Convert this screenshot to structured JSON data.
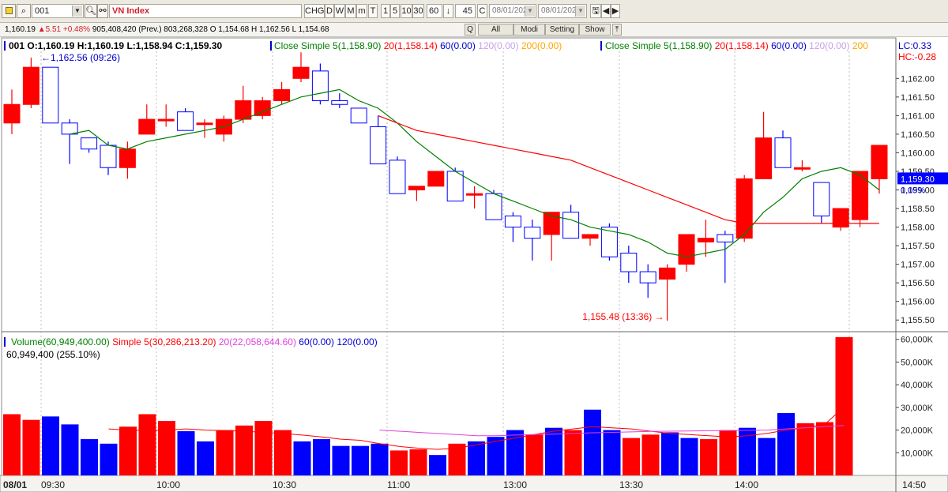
{
  "toolbar": {
    "symbol": "001",
    "index_name": "VN Index",
    "buttons": [
      "CHG",
      "D",
      "W",
      "M",
      "m",
      "T",
      "1",
      "5",
      "10",
      "30"
    ],
    "interval": "60",
    "count": "45",
    "c_label": "C",
    "date_from": "08/01/202",
    "date_to": "08/01/202"
  },
  "quotebar": {
    "last": "1,160.19",
    "change": "5.51",
    "change_pct": "+0.48%",
    "volume": "905,408,420",
    "prev": "(Prev.) 803,268,328",
    "ohl": "O 1,154.68 H 1,162.56 L 1,154.68",
    "buttons": [
      "Q",
      "All",
      "Modi",
      "Setting",
      "Show"
    ]
  },
  "price_panel": {
    "header": "001 O:1,160.19 H:1,160.19 L:1,158.94 C:1,159.30",
    "ma_legend_1": [
      {
        "text": "Close Simple 5(1,158.90)",
        "color": "#008000"
      },
      {
        "text": "20(1,158.14)",
        "color": "#ff0000"
      },
      {
        "text": "60(0.00)",
        "color": "#0000cc"
      },
      {
        "text": "120(0.00)",
        "color": "#c8a0e6"
      },
      {
        "text": "200(0.00)",
        "color": "#ffa500"
      }
    ],
    "ma_legend_2": [
      {
        "text": "Close Simple 5(1,158.90)",
        "color": "#008000"
      },
      {
        "text": "20(1,158.14)",
        "color": "#ff0000"
      },
      {
        "text": "60(0.00)",
        "color": "#0000cc"
      },
      {
        "text": "120(0.00)",
        "color": "#c8a0e6"
      },
      {
        "text": "200",
        "color": "#ffa500"
      }
    ],
    "lc_label": "LC:0.33",
    "hc_label": "HC:-0.28",
    "high_annotation": "1,162.56 (09:26)",
    "low_annotation": "1,155.48 (13:36)",
    "last_price_label": "1,159.30",
    "last_pct_label": "0.09%"
  },
  "volume_panel": {
    "legend": [
      {
        "text": "Volume(60,949,400.00)",
        "color": "#008000"
      },
      {
        "text": "Simple 5(30,286,213.20)",
        "color": "#ff0000"
      },
      {
        "text": "20(22,058,644.60)",
        "color": "#e040e0"
      },
      {
        "text": "60(0.00)",
        "color": "#0000cc"
      },
      {
        "text": "120(0.00)",
        "color": "#0000cc"
      }
    ],
    "sub_label": "60,949,400 (255.10%)"
  },
  "colors": {
    "up": "#ff0000",
    "down": "#0000ff",
    "ma5": "#008000",
    "ma20": "#ff0000",
    "vol_ma5": "#ff0000",
    "vol_ma20": "#e040e0"
  },
  "chart_data": [
    {
      "type": "candlestick",
      "title": "VN Index",
      "ylim": [
        1155.25,
        1162.75
      ],
      "y_ticks": [
        "1,162.00",
        "1,161.50",
        "1,161.00",
        "1,160.50",
        "1,160.00",
        "1,159.50",
        "1,159.00",
        "1,158.50",
        "1,158.00",
        "1,157.50",
        "1,157.00",
        "1,156.50",
        "1,156.00",
        "1,155.50"
      ],
      "x_tick_labels": [
        "08/01",
        "09:30",
        "10:00",
        "10:30",
        "11:00",
        "13:00",
        "13:30",
        "14:00",
        "14:50"
      ],
      "candles": [
        {
          "o": 1160.8,
          "h": 1161.7,
          "l": 1160.5,
          "c": 1161.3
        },
        {
          "o": 1161.3,
          "h": 1162.56,
          "l": 1161.2,
          "c": 1162.3
        },
        {
          "o": 1162.3,
          "h": 1162.3,
          "l": 1160.8,
          "c": 1160.8
        },
        {
          "o": 1160.8,
          "h": 1160.9,
          "l": 1159.7,
          "c": 1160.5
        },
        {
          "o": 1160.4,
          "h": 1160.4,
          "l": 1160.0,
          "c": 1160.1
        },
        {
          "o": 1160.2,
          "h": 1160.3,
          "l": 1159.4,
          "c": 1159.6
        },
        {
          "o": 1159.6,
          "h": 1160.3,
          "l": 1159.3,
          "c": 1160.1
        },
        {
          "o": 1160.5,
          "h": 1161.3,
          "l": 1160.5,
          "c": 1160.9
        },
        {
          "o": 1160.9,
          "h": 1161.3,
          "l": 1160.7,
          "c": 1160.9
        },
        {
          "o": 1161.1,
          "h": 1161.2,
          "l": 1160.6,
          "c": 1160.6
        },
        {
          "o": 1160.8,
          "h": 1160.9,
          "l": 1160.4,
          "c": 1160.8
        },
        {
          "o": 1160.5,
          "h": 1161.0,
          "l": 1160.3,
          "c": 1160.9
        },
        {
          "o": 1160.9,
          "h": 1161.8,
          "l": 1160.8,
          "c": 1161.4
        },
        {
          "o": 1161.0,
          "h": 1161.5,
          "l": 1160.9,
          "c": 1161.4
        },
        {
          "o": 1161.4,
          "h": 1161.9,
          "l": 1161.3,
          "c": 1161.7
        },
        {
          "o": 1162.0,
          "h": 1162.7,
          "l": 1161.9,
          "c": 1162.3
        },
        {
          "o": 1162.2,
          "h": 1162.4,
          "l": 1161.3,
          "c": 1161.4
        },
        {
          "o": 1161.4,
          "h": 1161.6,
          "l": 1161.2,
          "c": 1161.3
        },
        {
          "o": 1161.2,
          "h": 1161.2,
          "l": 1160.8,
          "c": 1160.8
        },
        {
          "o": 1160.7,
          "h": 1161.0,
          "l": 1159.7,
          "c": 1159.7
        },
        {
          "o": 1159.8,
          "h": 1159.9,
          "l": 1158.9,
          "c": 1158.9
        },
        {
          "o": 1159.0,
          "h": 1159.1,
          "l": 1158.7,
          "c": 1159.1
        },
        {
          "o": 1159.1,
          "h": 1159.5,
          "l": 1159.1,
          "c": 1159.5
        },
        {
          "o": 1159.5,
          "h": 1159.6,
          "l": 1158.7,
          "c": 1158.7
        },
        {
          "o": 1158.9,
          "h": 1159.1,
          "l": 1158.5,
          "c": 1158.9
        },
        {
          "o": 1158.9,
          "h": 1159.0,
          "l": 1158.2,
          "c": 1158.2
        },
        {
          "o": 1158.3,
          "h": 1158.4,
          "l": 1157.6,
          "c": 1158.0
        },
        {
          "o": 1158.0,
          "h": 1158.2,
          "l": 1157.1,
          "c": 1157.7
        },
        {
          "o": 1157.8,
          "h": 1158.4,
          "l": 1157.1,
          "c": 1158.4
        },
        {
          "o": 1158.4,
          "h": 1158.6,
          "l": 1157.8,
          "c": 1157.7
        },
        {
          "o": 1157.7,
          "h": 1157.8,
          "l": 1157.5,
          "c": 1157.8
        },
        {
          "o": 1158.0,
          "h": 1158.1,
          "l": 1157.1,
          "c": 1157.2
        },
        {
          "o": 1157.3,
          "h": 1157.5,
          "l": 1156.5,
          "c": 1156.8
        },
        {
          "o": 1156.8,
          "h": 1157.0,
          "l": 1156.1,
          "c": 1156.5
        },
        {
          "o": 1156.6,
          "h": 1157.0,
          "l": 1155.48,
          "c": 1156.9
        },
        {
          "o": 1157.0,
          "h": 1157.8,
          "l": 1156.8,
          "c": 1157.8
        },
        {
          "o": 1157.6,
          "h": 1158.2,
          "l": 1157.2,
          "c": 1157.7
        },
        {
          "o": 1157.8,
          "h": 1157.9,
          "l": 1156.5,
          "c": 1157.6
        },
        {
          "o": 1157.7,
          "h": 1159.4,
          "l": 1157.6,
          "c": 1159.3
        },
        {
          "o": 1159.3,
          "h": 1161.1,
          "l": 1159.3,
          "c": 1160.4
        },
        {
          "o": 1160.4,
          "h": 1160.6,
          "l": 1159.6,
          "c": 1159.6
        },
        {
          "o": 1159.6,
          "h": 1159.8,
          "l": 1159.5,
          "c": 1159.6
        },
        {
          "o": 1159.2,
          "h": 1159.2,
          "l": 1158.1,
          "c": 1158.3
        },
        {
          "o": 1158.0,
          "h": 1158.5,
          "l": 1157.9,
          "c": 1158.5
        },
        {
          "o": 1158.2,
          "h": 1159.5,
          "l": 1158.0,
          "c": 1159.5
        },
        {
          "o": 1159.3,
          "h": 1160.2,
          "l": 1158.9,
          "c": 1160.2
        }
      ],
      "ma5": [
        null,
        null,
        null,
        1160.5,
        1160.6,
        1160.2,
        1160.1,
        1160.3,
        1160.4,
        1160.5,
        1160.6,
        1160.7,
        1160.9,
        1161.1,
        1161.3,
        1161.5,
        1161.6,
        1161.7,
        1161.4,
        1161.2,
        1160.8,
        1160.3,
        1159.9,
        1159.5,
        1159.2,
        1158.9,
        1158.7,
        1158.5,
        1158.3,
        1158.2,
        1158.0,
        1157.9,
        1157.8,
        1157.6,
        1157.3,
        1157.2,
        1157.3,
        1157.4,
        1157.8,
        1158.4,
        1158.8,
        1159.3,
        1159.5,
        1159.6,
        1159.4,
        1159.0
      ],
      "ma20": [
        null,
        null,
        null,
        null,
        null,
        null,
        null,
        null,
        null,
        null,
        null,
        null,
        null,
        null,
        null,
        null,
        null,
        null,
        null,
        1161.0,
        1160.8,
        1160.6,
        1160.5,
        1160.4,
        1160.3,
        1160.2,
        1160.1,
        1160.0,
        1159.9,
        1159.8,
        1159.6,
        1159.4,
        1159.2,
        1159.0,
        1158.8,
        1158.6,
        1158.4,
        1158.2,
        1158.1,
        1158.1,
        1158.1,
        1158.1,
        1158.1,
        1158.1,
        1158.1,
        1158.1
      ]
    },
    {
      "type": "bar",
      "title": "Volume",
      "ylim": [
        0,
        62000000
      ],
      "y_ticks": [
        "60,000K",
        "50,000K",
        "40,000K",
        "30,000K",
        "20,000K",
        "10,000K"
      ],
      "values": [
        27000000,
        24500000,
        26000000,
        22500000,
        16000000,
        14000000,
        21500000,
        27000000,
        24000000,
        19500000,
        15000000,
        20000000,
        22000000,
        24000000,
        20000000,
        15000000,
        16000000,
        13000000,
        13000000,
        14000000,
        11000000,
        11500000,
        9000000,
        14000000,
        15000000,
        17000000,
        20000000,
        18000000,
        21000000,
        20000000,
        29000000,
        20000000,
        16500000,
        18000000,
        19000000,
        16500000,
        16000000,
        20000000,
        21000000,
        16500000,
        27500000,
        23000000,
        23500000,
        61000000
      ],
      "up": [
        true,
        true,
        false,
        false,
        false,
        false,
        true,
        true,
        true,
        false,
        false,
        true,
        true,
        true,
        true,
        false,
        false,
        false,
        false,
        false,
        true,
        true,
        false,
        true,
        false,
        false,
        false,
        true,
        false,
        true,
        false,
        false,
        true,
        true,
        false,
        false,
        true,
        true,
        false,
        false,
        false,
        true,
        true,
        true
      ],
      "ma5": [
        null,
        null,
        null,
        null,
        null,
        20500000,
        20000000,
        19800000,
        20000000,
        20500000,
        20000000,
        19800000,
        19500000,
        19000000,
        18500000,
        17800000,
        17000000,
        16000000,
        15500000,
        14000000,
        12800000,
        12000000,
        11500000,
        12000000,
        13500000,
        15000000,
        16500000,
        18000000,
        19500000,
        20500000,
        21500000,
        21000000,
        20500000,
        19500000,
        18500000,
        18000000,
        17500000,
        17000000,
        17500000,
        18500000,
        20000000,
        21000000,
        22500000,
        30286213
      ],
      "ma20": [
        null,
        null,
        null,
        null,
        null,
        null,
        null,
        null,
        null,
        null,
        null,
        null,
        null,
        null,
        null,
        null,
        null,
        null,
        null,
        20000000,
        19500000,
        19000000,
        18500000,
        18000000,
        17500000,
        17500000,
        17800000,
        18000000,
        18200000,
        18500000,
        18800000,
        19000000,
        19200000,
        19400000,
        19500000,
        19600000,
        19700000,
        19800000,
        19900000,
        20000000,
        20500000,
        21000000,
        21500000,
        22058644
      ]
    }
  ]
}
